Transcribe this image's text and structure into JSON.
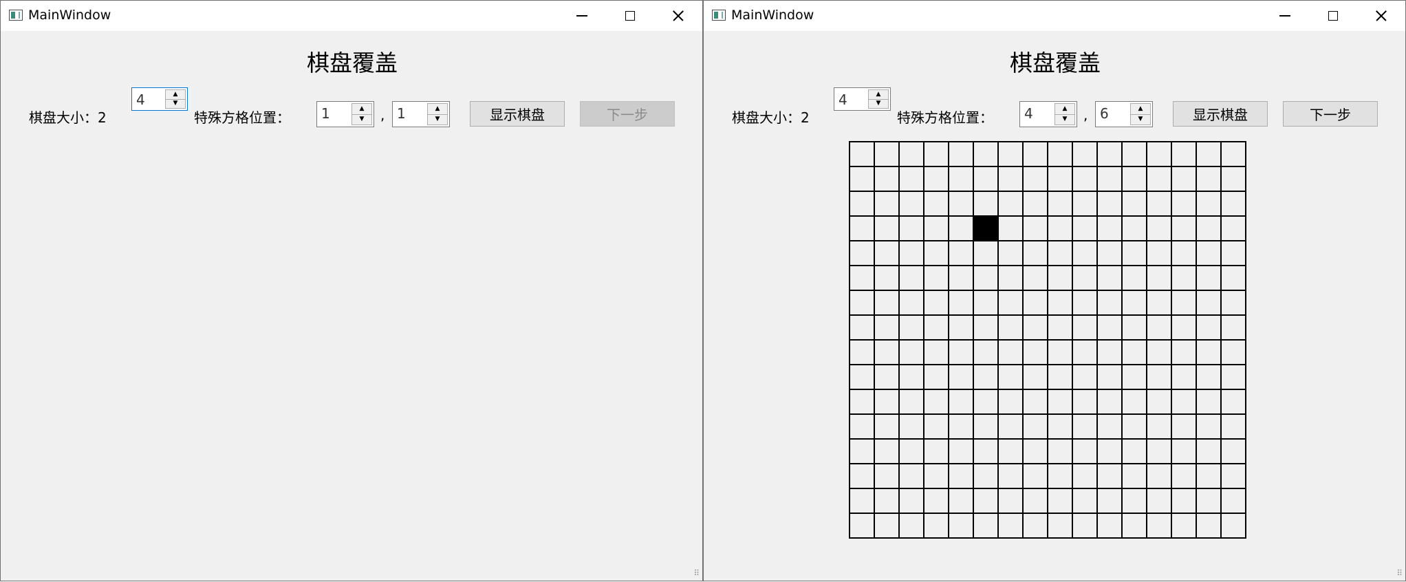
{
  "windows": [
    {
      "title": "MainWindow",
      "heading": "棋盘覆盖",
      "size_label": "棋盘大小：2",
      "size_value": "4",
      "special_label": "特殊方格位置：",
      "special_row": "1",
      "special_col": "1",
      "comma": ",",
      "show_button": "显示棋盘",
      "next_button": "下一步",
      "next_enabled": false
    },
    {
      "title": "MainWindow",
      "heading": "棋盘覆盖",
      "size_label": "棋盘大小：2",
      "size_value": "4",
      "special_label": "特殊方格位置：",
      "special_row": "4",
      "special_col": "6",
      "comma": ",",
      "show_button": "显示棋盘",
      "next_button": "下一步",
      "next_enabled": true,
      "board": {
        "grid_size": 16,
        "special_cell": {
          "row": 4,
          "col": 6
        },
        "line_color": "#000000",
        "special_color": "#000000"
      }
    }
  ],
  "icons": {
    "app": "window-app-icon",
    "minimize": "minimize-icon",
    "maximize": "maximize-icon",
    "close": "close-icon",
    "spin_up": "▲",
    "spin_down": "▼",
    "grip": "resize-grip-icon"
  }
}
